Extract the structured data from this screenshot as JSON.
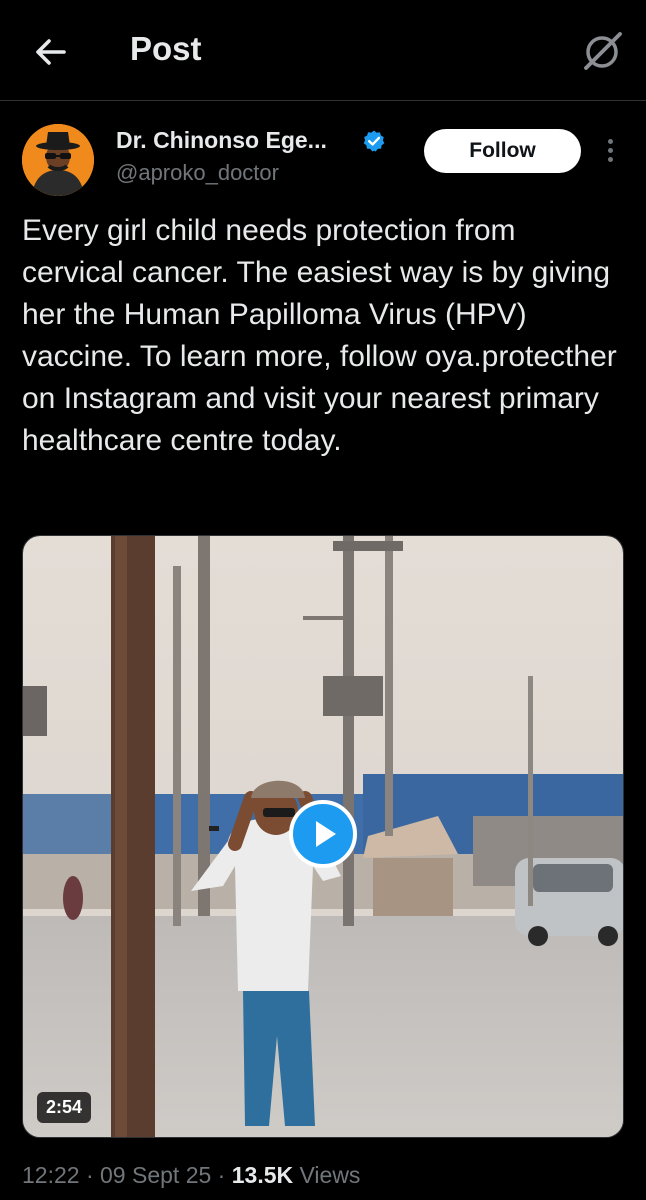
{
  "header": {
    "title": "Post"
  },
  "author": {
    "name": "Dr. Chinonso Ege...",
    "handle": "@aproko_doctor",
    "follow_label": "Follow"
  },
  "post": {
    "text": "Every girl child needs protection from cervical cancer. The easiest way is by giving her the Human Papilloma Virus (HPV) vaccine. To learn more, follow oya.protecther on Instagram and visit your nearest primary healthcare centre today."
  },
  "video": {
    "duration": "2:54"
  },
  "meta": {
    "time": "12:22",
    "separator": "·",
    "date": "09 Sept 25",
    "views_count": "13.5K",
    "views_label": "Views"
  },
  "colors": {
    "background": "#000000",
    "accent": "#1d9bf0",
    "text_primary": "#e7e9ea",
    "text_secondary": "#71767b",
    "divider": "#2f3336"
  },
  "icons": {
    "back": "arrow-left-icon",
    "grok": "grok-icon",
    "verified": "verified-badge-icon",
    "more": "more-vertical-icon",
    "play": "play-icon"
  }
}
